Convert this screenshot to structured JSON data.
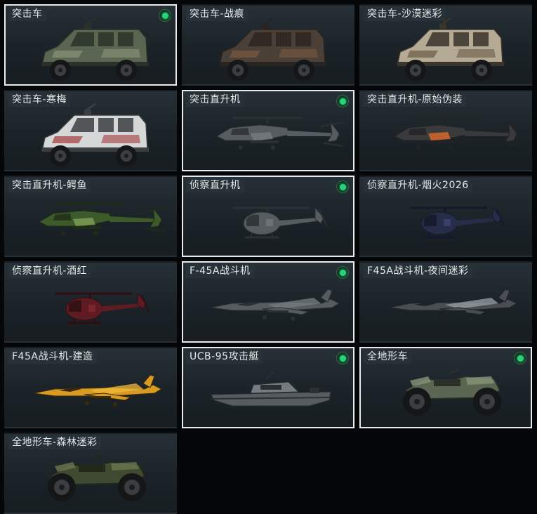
{
  "vehicles": [
    {
      "name": "突击车",
      "kind": "truck",
      "skin": "green",
      "selected": true,
      "equipped": true
    },
    {
      "name": "突击车-战痕",
      "kind": "truck",
      "skin": "rust",
      "selected": false,
      "equipped": false
    },
    {
      "name": "突击车-沙漠迷彩",
      "kind": "truck",
      "skin": "desert",
      "selected": false,
      "equipped": false
    },
    {
      "name": "突击车-寒梅",
      "kind": "truck",
      "skin": "white",
      "selected": false,
      "equipped": false
    },
    {
      "name": "突击直升机",
      "kind": "attack-heli",
      "skin": "grey",
      "selected": true,
      "equipped": true
    },
    {
      "name": "突击直升机-原始伪装",
      "kind": "attack-heli",
      "skin": "orange",
      "selected": false,
      "equipped": false
    },
    {
      "name": "突击直升机-鳄鱼",
      "kind": "attack-heli",
      "skin": "croc",
      "selected": false,
      "equipped": false
    },
    {
      "name": "侦察直升机",
      "kind": "scout-heli",
      "skin": "grey",
      "selected": true,
      "equipped": true
    },
    {
      "name": "侦察直升机-烟火2026",
      "kind": "scout-heli",
      "skin": "navy",
      "selected": false,
      "equipped": false
    },
    {
      "name": "侦察直升机-酒红",
      "kind": "scout-heli",
      "skin": "wine",
      "selected": false,
      "equipped": false
    },
    {
      "name": "F-45A战斗机",
      "kind": "jet",
      "skin": "grey",
      "selected": true,
      "equipped": true
    },
    {
      "name": "F45A战斗机-夜间迷彩",
      "kind": "jet",
      "skin": "nightcamo",
      "selected": false,
      "equipped": false
    },
    {
      "name": "F45A战斗机-建造",
      "kind": "jet",
      "skin": "yellow",
      "selected": false,
      "equipped": false
    },
    {
      "name": "UCB-95攻击艇",
      "kind": "boat",
      "skin": "grey",
      "selected": true,
      "equipped": true
    },
    {
      "name": "全地形车",
      "kind": "atv",
      "skin": "green",
      "selected": true,
      "equipped": true
    },
    {
      "name": "全地形车-森林迷彩",
      "kind": "atv",
      "skin": "forest",
      "selected": false,
      "equipped": false
    }
  ],
  "skins": {
    "green": {
      "body": "#5b6652",
      "accent": "#8a9478",
      "dark": "#2b3128"
    },
    "rust": {
      "body": "#4a4038",
      "accent": "#7a5a40",
      "dark": "#2a2420"
    },
    "desert": {
      "body": "#b5aa94",
      "accent": "#6b5a44",
      "dark": "#3a342c"
    },
    "white": {
      "body": "#d6d8d8",
      "accent": "#a23a3a",
      "dark": "#3b3f42"
    },
    "grey": {
      "body": "#565c60",
      "accent": "#767d82",
      "dark": "#2c3033"
    },
    "orange": {
      "body": "#3a3a3c",
      "accent": "#e06a2a",
      "dark": "#222325"
    },
    "croc": {
      "body": "#3d5a2a",
      "accent": "#7fa056",
      "dark": "#1f2d17"
    },
    "navy": {
      "body": "#262d48",
      "accent": "#3d4a72",
      "dark": "#15192a"
    },
    "wine": {
      "body": "#5e1c22",
      "accent": "#8a2a32",
      "dark": "#2e0e12"
    },
    "nightcamo": {
      "body": "#4a4e54",
      "accent": "#9aa0a6",
      "dark": "#202326"
    },
    "yellow": {
      "body": "#d89a22",
      "accent": "#f0b83a",
      "dark": "#3a2a0a"
    },
    "forest": {
      "body": "#404a30",
      "accent": "#6c7650",
      "dark": "#22281a"
    }
  }
}
